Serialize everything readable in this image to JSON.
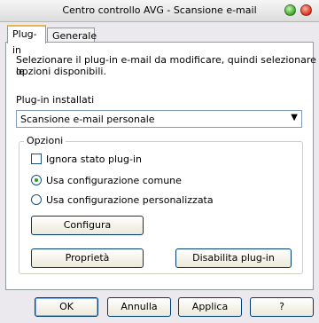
{
  "window": {
    "title": "Centro controllo AVG - Scansione e-mail"
  },
  "tabs": [
    {
      "label": "Plug-in",
      "active": true
    },
    {
      "label": "Generale",
      "active": false
    }
  ],
  "panel": {
    "description_line1": "Selezionare il plug-in e-mail da modificare, quindi selezionare le",
    "description_line2": "opzioni disponibili.",
    "installed_label": "Plug-in installati",
    "installed_selected": "Scansione e-mail personale"
  },
  "options": {
    "legend": "Opzioni",
    "ignore_state_label": "Ignora stato plug-in",
    "ignore_state_checked": false,
    "radio_common_label": "Usa configurazione comune",
    "radio_custom_label": "Usa configurazione personalizzata",
    "selected_config": "Usa configurazione comune",
    "configure_button": "Configura",
    "properties_button": "Proprietà",
    "disable_button": "Disabilita plug-in"
  },
  "footer": {
    "ok": "OK",
    "cancel": "Annulla",
    "apply": "Applica",
    "help": "?"
  },
  "icons": {
    "maximize": "green-circle-icon",
    "close": "red-circle-icon",
    "dropdown": "dropdown-arrow-icon"
  }
}
